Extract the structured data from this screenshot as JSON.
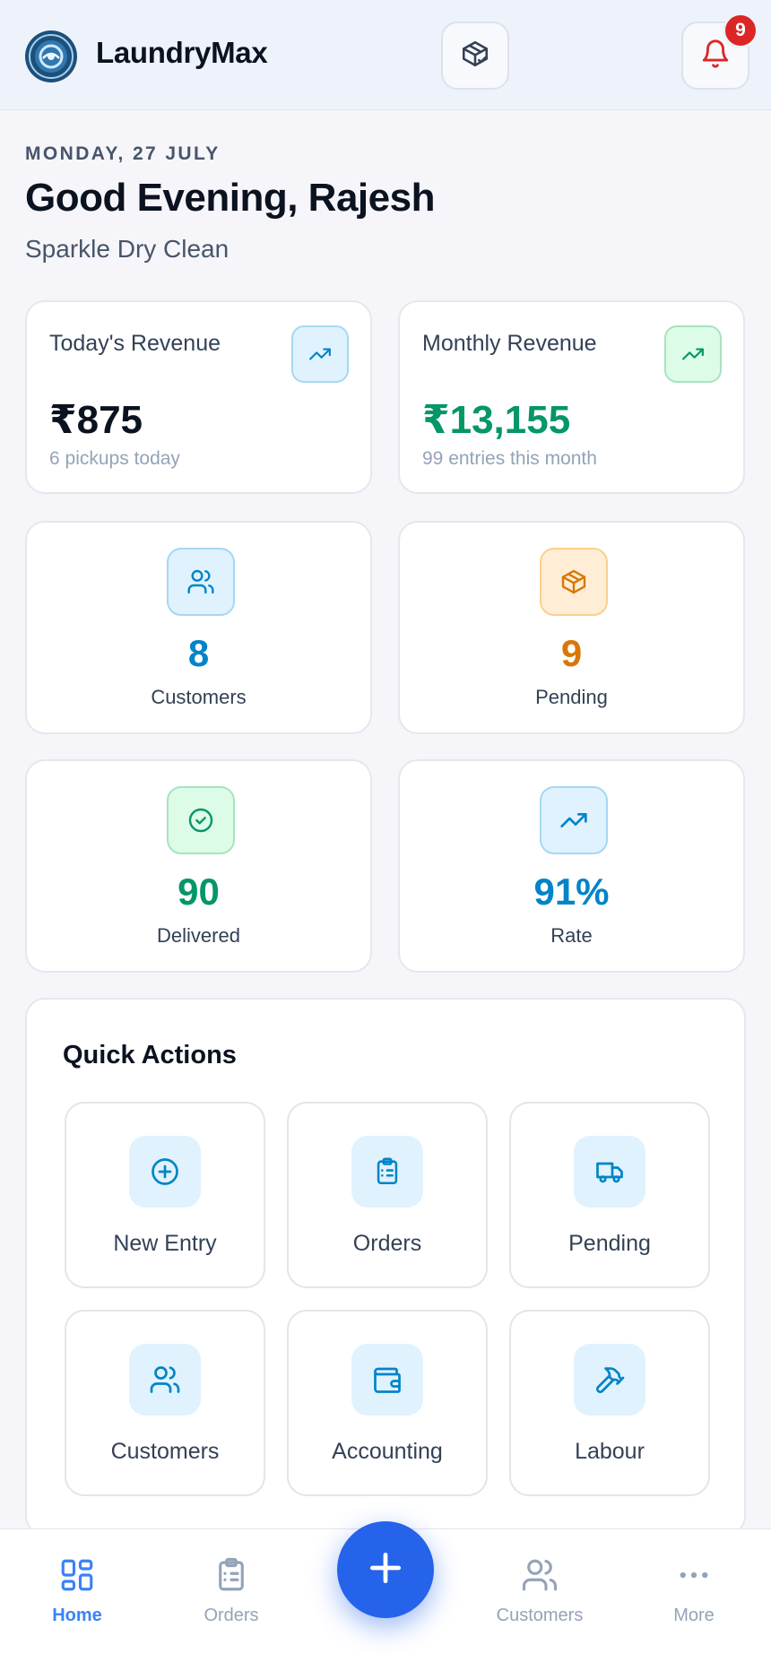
{
  "header": {
    "brand": "LaundryMax",
    "notification_count": "9",
    "icons": [
      "logo-icon",
      "package-check-icon",
      "bell-icon"
    ]
  },
  "greeting": {
    "date": "MONDAY, 27 JULY",
    "title": "Good Evening, Rajesh",
    "shop_name": "Sparkle Dry Clean"
  },
  "revenue": {
    "today": {
      "label": "Today's Revenue",
      "value": "₹875",
      "sub": "6 pickups today",
      "icon": "trending-up-icon"
    },
    "monthly": {
      "label": "Monthly Revenue",
      "value": "₹13,155",
      "sub": "99 entries this month",
      "icon": "trending-up-icon"
    }
  },
  "stats": [
    {
      "value": "8",
      "label": "Customers",
      "icon": "users-icon",
      "color": "#0284c7"
    },
    {
      "value": "9",
      "label": "Pending",
      "icon": "package-icon",
      "color": "#d97706"
    },
    {
      "value": "90",
      "label": "Delivered",
      "icon": "check-circle-icon",
      "color": "#059669"
    },
    {
      "value": "91%",
      "label": "Rate",
      "icon": "trending-up-icon",
      "color": "#0284c7"
    }
  ],
  "quick_actions": {
    "title": "Quick Actions",
    "items": [
      {
        "label": "New Entry",
        "icon": "plus-circle-icon"
      },
      {
        "label": "Orders",
        "icon": "clipboard-list-icon"
      },
      {
        "label": "Pending",
        "icon": "truck-icon"
      },
      {
        "label": "Customers",
        "icon": "users-icon"
      },
      {
        "label": "Accounting",
        "icon": "wallet-icon"
      },
      {
        "label": "Labour",
        "icon": "hammer-icon"
      }
    ]
  },
  "bottom_nav": {
    "items": [
      {
        "label": "Home",
        "icon": "grid-icon",
        "active": true
      },
      {
        "label": "Orders",
        "icon": "clipboard-icon",
        "active": false
      },
      {
        "label": "Customers",
        "icon": "users-icon",
        "active": false
      },
      {
        "label": "More",
        "icon": "more-horizontal-icon",
        "active": false
      }
    ],
    "fab_icon": "plus-icon"
  },
  "colors": {
    "accent": "#2563eb",
    "brand_blue": "#0284c7",
    "success": "#059669",
    "warning": "#d97706",
    "danger": "#dc2626"
  }
}
